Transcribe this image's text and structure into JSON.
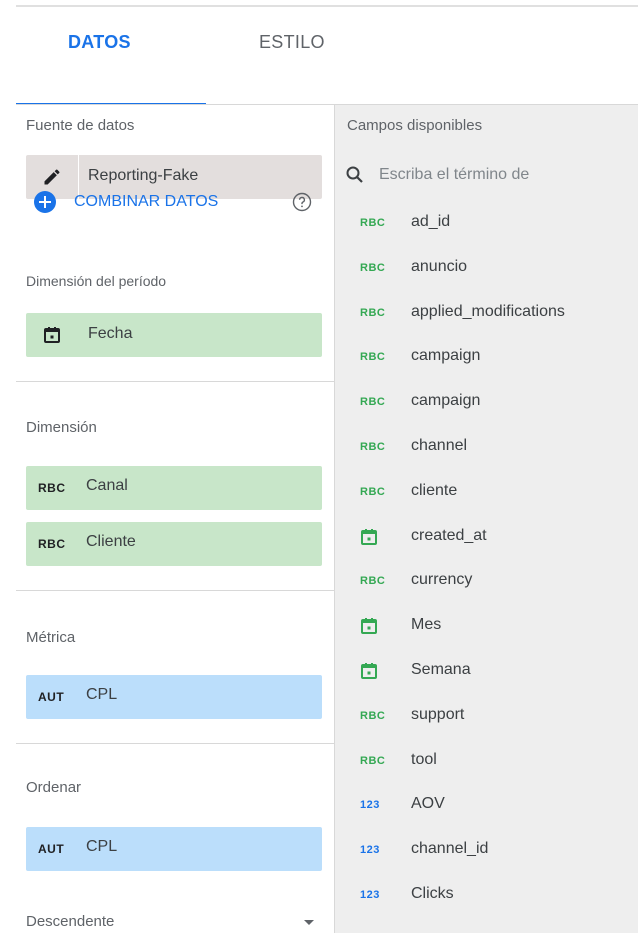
{
  "tabs": [
    {
      "label": "DATOS",
      "active": true
    },
    {
      "label": "ESTILO",
      "active": false
    }
  ],
  "left": {
    "data_source_label": "Fuente de datos",
    "data_source_value": "Reporting-Fake",
    "combine_label": "COMBINAR DATOS",
    "period_label": "Dimensión del período",
    "period_value": "Fecha",
    "dimension_label": "Dimensión",
    "dimensions": [
      {
        "tag": "RBC",
        "name": "Canal"
      },
      {
        "tag": "RBC",
        "name": "Cliente"
      }
    ],
    "metric_label": "Métrica",
    "metric": {
      "tag": "AUT",
      "name": "CPL"
    },
    "sort_label": "Ordenar",
    "sort": {
      "tag": "AUT",
      "name": "CPL"
    },
    "sort_order": "Descendente"
  },
  "right": {
    "title": "Campos disponibles",
    "search_placeholder": "Escriba el término de",
    "fields": [
      {
        "type": "dimension",
        "tag": "RBC",
        "name": "ad_id"
      },
      {
        "type": "dimension",
        "tag": "RBC",
        "name": "anuncio"
      },
      {
        "type": "dimension",
        "tag": "RBC",
        "name": "applied_modifications"
      },
      {
        "type": "dimension",
        "tag": "RBC",
        "name": "campaign"
      },
      {
        "type": "dimension",
        "tag": "RBC",
        "name": "campaign"
      },
      {
        "type": "dimension",
        "tag": "RBC",
        "name": "channel"
      },
      {
        "type": "dimension",
        "tag": "RBC",
        "name": "cliente"
      },
      {
        "type": "date",
        "tag": "calendar-icon",
        "name": "created_at"
      },
      {
        "type": "dimension",
        "tag": "RBC",
        "name": "currency"
      },
      {
        "type": "date",
        "tag": "calendar-icon",
        "name": "Mes"
      },
      {
        "type": "date",
        "tag": "calendar-icon",
        "name": "Semana"
      },
      {
        "type": "dimension",
        "tag": "RBC",
        "name": "support"
      },
      {
        "type": "dimension",
        "tag": "RBC",
        "name": "tool"
      },
      {
        "type": "metric",
        "tag": "123",
        "name": "AOV"
      },
      {
        "type": "metric",
        "tag": "123",
        "name": "channel_id"
      },
      {
        "type": "metric",
        "tag": "123",
        "name": "Clicks"
      }
    ]
  },
  "icons": {
    "edit": "pencil-icon",
    "combine": "plus-circle-icon",
    "help": "help-icon",
    "search": "search-icon",
    "calendar": "calendar-icon"
  },
  "colors": {
    "accent": "#1a73e8",
    "dimension_green": "#c8e6c9",
    "metric_blue": "#bbdefb",
    "dimension_tag": "#34a853",
    "metric_tag": "#1a73e8",
    "source_gray": "#e3dedd",
    "panel_gray": "#eeeeee"
  }
}
